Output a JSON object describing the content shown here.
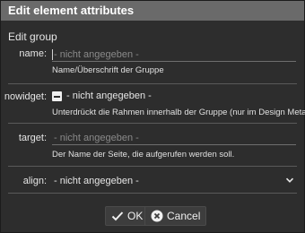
{
  "dialog": {
    "title": "Edit element attributes",
    "group_title": "Edit group"
  },
  "fields": {
    "name": {
      "label": "name:",
      "placeholder": "- nicht angegeben -",
      "hint": "Name/Überschrift der Gruppe"
    },
    "nowidget": {
      "label": "nowidget:",
      "value_text": "- nicht angegeben -",
      "hint": "Unterdrückt die Rahmen innerhalb der Gruppe (nur im Design Metal)"
    },
    "target": {
      "label": "target:",
      "placeholder": "- nicht angegeben -",
      "hint": "Der Name der Seite, die aufgerufen werden soll."
    },
    "align": {
      "label": "align:",
      "selected": "- nicht angegeben -",
      "icon": "chevron-down-icon"
    }
  },
  "buttons": {
    "ok_label": "OK",
    "ok_icon": "checkmark-icon",
    "cancel_label": "Cancel",
    "cancel_icon": "cancel-circle-icon"
  },
  "colors": {
    "titlebar": "#6a6a6a",
    "background": "#2d2d2d",
    "text": "#e6e6e6",
    "placeholder": "#8a8a8a"
  }
}
